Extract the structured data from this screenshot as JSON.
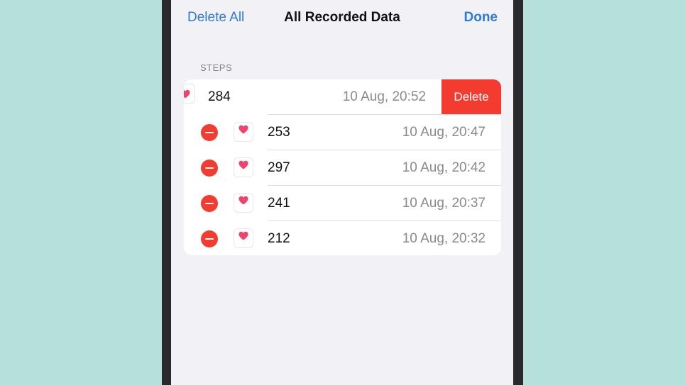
{
  "nav": {
    "left_label": "Delete All",
    "title": "All Recorded Data",
    "right_label": "Done"
  },
  "section": {
    "header": "STEPS"
  },
  "swiped_row": {
    "value": "284",
    "date": "10 Aug, 20:52",
    "action_label": "Delete"
  },
  "rows": [
    {
      "value": "253",
      "date": "10 Aug, 20:47"
    },
    {
      "value": "297",
      "date": "10 Aug, 20:42"
    },
    {
      "value": "241",
      "date": "10 Aug, 20:37"
    },
    {
      "value": "212",
      "date": "10 Aug, 20:32"
    }
  ],
  "icons": {
    "app_icon": "heart-icon",
    "delete_control": "minus-circle-icon"
  },
  "colors": {
    "accent": "#2f7ad9",
    "destructive": "#f33b30",
    "heart": "#f0436b",
    "background": "#b5e0dc"
  }
}
